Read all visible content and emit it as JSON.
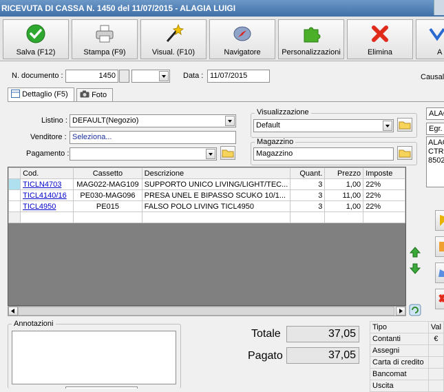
{
  "window": {
    "title": "RICEVUTA DI CASSA N. 1450 del 11/07/2015 - ALAGIA LUIGI"
  },
  "toolbar": {
    "buttons": [
      {
        "label": "Salva (F12)"
      },
      {
        "label": "Stampa (F9)"
      },
      {
        "label": "Visual. (F10)"
      },
      {
        "label": "Navigatore"
      },
      {
        "label": "Personalizzazioni"
      },
      {
        "label": "Elimina"
      },
      {
        "label": "A"
      }
    ]
  },
  "header": {
    "doc_number_label": "N. documento :",
    "doc_number": "1450",
    "data_label": "Data :",
    "data_value": "11/07/2015",
    "causale_label": "Causale"
  },
  "tabs": [
    {
      "label": "Dettaglio (F5)"
    },
    {
      "label": "Foto"
    }
  ],
  "form": {
    "listino_label": "Listino :",
    "listino_value": "DEFAULT(Negozio)",
    "venditore_label": "Venditore :",
    "venditore_value": "Seleziona...",
    "pagamento_label": "Pagamento :",
    "pagamento_value": ""
  },
  "visualizzazione": {
    "title": "Visualizzazione",
    "value": "Default"
  },
  "magazzino": {
    "title": "Magazzino",
    "value": "Magazzino"
  },
  "customer": {
    "line1": "ALAG",
    "line2": "Egr.",
    "addr1": "ALAG",
    "addr2": "CTR",
    "addr3": "8502"
  },
  "grid": {
    "columns": [
      "Cod.",
      "Cassetto",
      "Descrizione",
      "Quant.",
      "Prezzo",
      "Imposte"
    ],
    "rows": [
      {
        "cod": "TICLN4703",
        "cassetto": "MAG022-MAG109",
        "descrizione": "SUPPORTO UNICO LIVING/LIGHT/TEC...",
        "quant": "3",
        "prezzo": "1,00",
        "imposte": "22%"
      },
      {
        "cod": "TICL4140/16",
        "cassetto": "PE030-MAG096",
        "descrizione": "PRESA UNEL E BIPASSO SCUKO 10/1...",
        "quant": "3",
        "prezzo": "11,00",
        "imposte": "22%"
      },
      {
        "cod": "TICL4950",
        "cassetto": "PE015",
        "descrizione": "FALSO POLO LIVING TICL4950",
        "quant": "3",
        "prezzo": "1,00",
        "imposte": "22%"
      }
    ]
  },
  "annotazioni": {
    "title": "Annotazioni"
  },
  "totals": {
    "totale_label": "Totale",
    "totale_value": "37,05",
    "pagato_label": "Pagato",
    "pagato_value": "37,05"
  },
  "payments": {
    "headers": [
      "Tipo",
      "Val"
    ],
    "rows": [
      {
        "tipo": "Contanti",
        "val": "€"
      },
      {
        "tipo": "Assegni",
        "val": ""
      },
      {
        "tipo": "Carta di credito",
        "val": ""
      },
      {
        "tipo": "Bancomat",
        "val": ""
      },
      {
        "tipo": "Uscita",
        "val": ""
      }
    ]
  },
  "colors": {
    "titlebar": "#3f6fa6",
    "link": "#0000cc",
    "grid_bg": "#808080"
  }
}
